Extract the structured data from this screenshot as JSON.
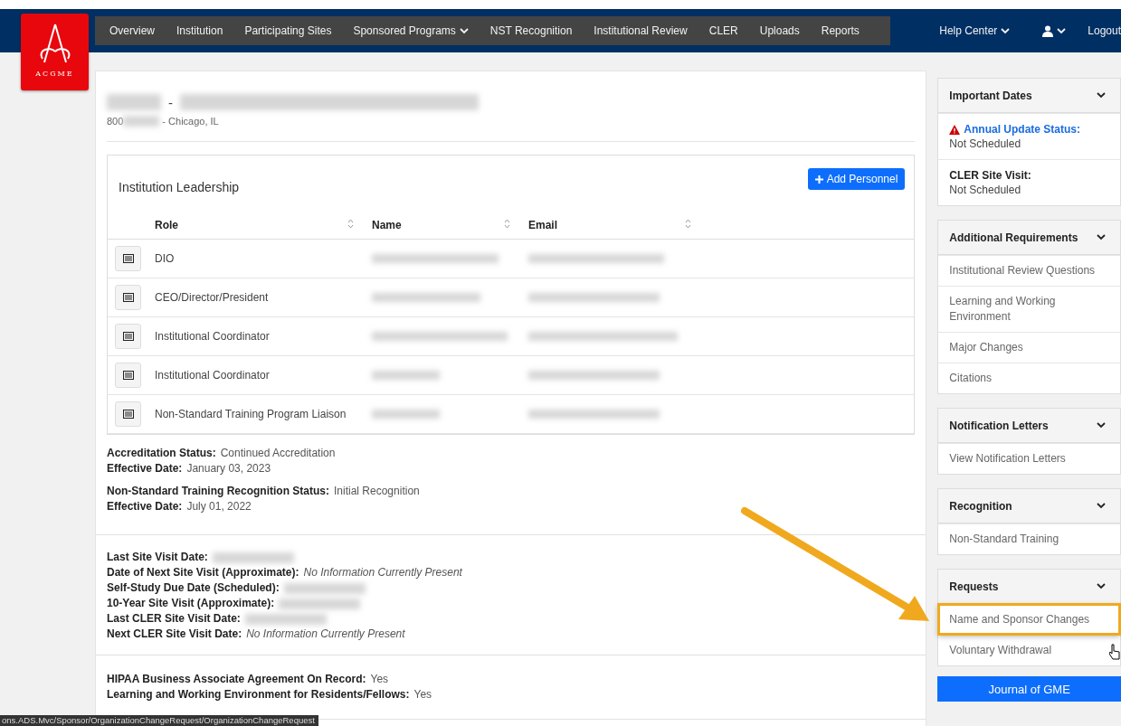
{
  "logo": {
    "text": "ACGME"
  },
  "nav": [
    {
      "label": "Overview",
      "dropdown": false
    },
    {
      "label": "Institution",
      "dropdown": false
    },
    {
      "label": "Participating Sites",
      "dropdown": false
    },
    {
      "label": "Sponsored Programs",
      "dropdown": true
    },
    {
      "label": "NST Recognition",
      "dropdown": false
    },
    {
      "label": "Institutional Review",
      "dropdown": false
    },
    {
      "label": "CLER",
      "dropdown": false
    },
    {
      "label": "Uploads",
      "dropdown": false
    },
    {
      "label": "Reports",
      "dropdown": false
    }
  ],
  "top_right": {
    "help": "Help Center",
    "logout": "Logout"
  },
  "institution": {
    "title_separator": "-",
    "code_prefix": "800",
    "location": "- Chicago, IL"
  },
  "leadership": {
    "title": "Institution Leadership",
    "add_button": "Add Personnel",
    "columns": [
      "Role",
      "Name",
      "Email"
    ],
    "rows": [
      {
        "role": "DIO"
      },
      {
        "role": "CEO/Director/President"
      },
      {
        "role": "Institutional Coordinator"
      },
      {
        "role": "Institutional Coordinator"
      },
      {
        "role": "Non-Standard Training Program Liaison"
      }
    ]
  },
  "status_groups": [
    [
      {
        "label": "Accreditation Status:",
        "value": "Continued Accreditation",
        "italic": false
      },
      {
        "label": "Effective Date:",
        "value": "January 03, 2023",
        "italic": false
      }
    ],
    [
      {
        "label": "Non-Standard Training Recognition Status:",
        "value": "Initial Recognition",
        "italic": false
      },
      {
        "label": "Effective Date:",
        "value": "July 01, 2022",
        "italic": false
      }
    ]
  ],
  "site_visits": [
    {
      "label": "Last Site Visit Date:",
      "kind": "redacted"
    },
    {
      "label": "Date of Next Site Visit (Approximate):",
      "kind": "text",
      "value": "No Information Currently Present",
      "italic": true
    },
    {
      "label": "Self-Study Due Date (Scheduled):",
      "kind": "redacted"
    },
    {
      "label": "10-Year Site Visit (Approximate):",
      "kind": "redacted"
    },
    {
      "label": "Last CLER Site Visit Date:",
      "kind": "redacted"
    },
    {
      "label": "Next CLER Site Visit Date:",
      "kind": "text",
      "value": "No Information Currently Present",
      "italic": true
    }
  ],
  "agreements": [
    {
      "label": "HIPAA Business Associate Agreement On Record:",
      "value": "Yes",
      "italic": false
    },
    {
      "label": "Learning and Working Environment for Residents/Fellows:",
      "value": "Yes",
      "italic": false
    }
  ],
  "sidebar": [
    {
      "title": "Important Dates",
      "items": [
        {
          "kind": "date",
          "label": "Annual Update Status:",
          "value": "Not Scheduled",
          "alert": true
        },
        {
          "kind": "date",
          "label": "CLER Site Visit:",
          "value": "Not Scheduled",
          "alert": false
        }
      ]
    },
    {
      "title": "Additional Requirements",
      "items": [
        {
          "kind": "link",
          "label": "Institutional Review Questions",
          "highlighted": false
        },
        {
          "kind": "link",
          "label": "Learning and Working Environment",
          "highlighted": false
        },
        {
          "kind": "link",
          "label": "Major Changes",
          "highlighted": false
        },
        {
          "kind": "link",
          "label": "Citations",
          "highlighted": false
        }
      ]
    },
    {
      "title": "Notification Letters",
      "items": [
        {
          "kind": "link",
          "label": "View Notification Letters",
          "highlighted": false
        }
      ]
    },
    {
      "title": "Recognition",
      "items": [
        {
          "kind": "link",
          "label": "Non-Standard Training",
          "highlighted": false
        }
      ]
    },
    {
      "title": "Requests",
      "items": [
        {
          "kind": "link",
          "label": "Name and Sponsor Changes",
          "highlighted": true
        },
        {
          "kind": "link",
          "label": "Voluntary Withdrawal",
          "highlighted": false
        }
      ]
    }
  ],
  "journal_button": "Journal of GME",
  "status_url": "ons.ADS.Mvc/Sponsor/OrganizationChangeRequest/OrganizationChangeRequest"
}
